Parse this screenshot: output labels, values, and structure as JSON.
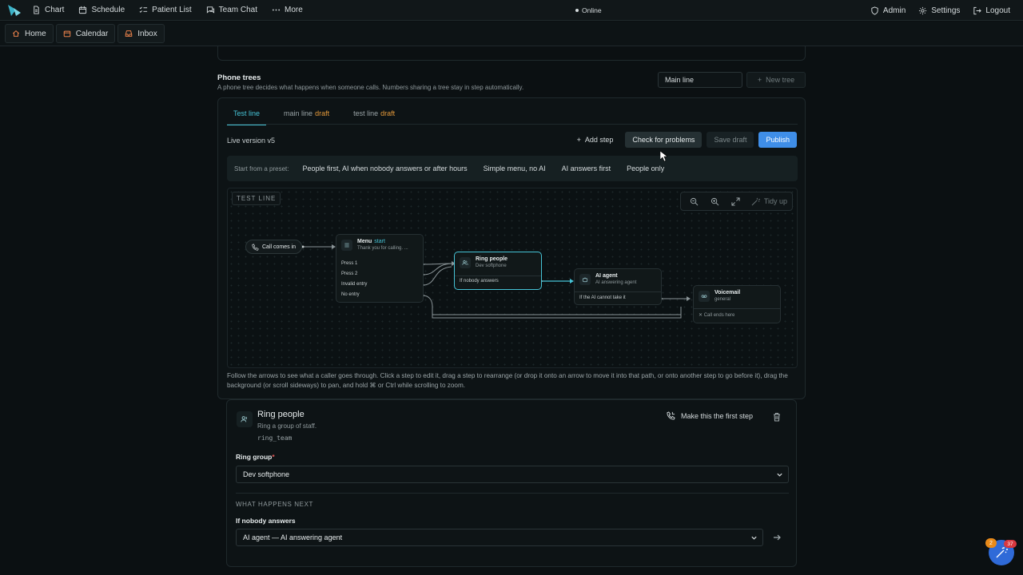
{
  "topbar": {
    "nav": [
      {
        "label": "Chart",
        "icon": "document-icon"
      },
      {
        "label": "Schedule",
        "icon": "calendar-icon"
      },
      {
        "label": "Patient List",
        "icon": "checklist-icon"
      },
      {
        "label": "Team Chat",
        "icon": "chat-icon"
      },
      {
        "label": "More",
        "icon": "more-dots-icon"
      }
    ],
    "status": "Online",
    "right": [
      {
        "label": "Admin",
        "icon": "shield-icon"
      },
      {
        "label": "Settings",
        "icon": "gear-icon"
      },
      {
        "label": "Logout",
        "icon": "logout-icon"
      }
    ]
  },
  "app_tabs": [
    {
      "label": "Home",
      "icon": "home-icon"
    },
    {
      "label": "Calendar",
      "icon": "calendar-icon"
    },
    {
      "label": "Inbox",
      "icon": "inbox-icon"
    }
  ],
  "phone_trees": {
    "title": "Phone trees",
    "description": "A phone tree decides what happens when someone calls. Numbers sharing a tree stay in step automatically.",
    "name_input_value": "Main line",
    "new_tree_label": "New tree"
  },
  "tree_tabs": [
    {
      "label": "Test line",
      "badge": ""
    },
    {
      "label": "main line",
      "badge": "draft"
    },
    {
      "label": "test line",
      "badge": "draft"
    }
  ],
  "editor": {
    "live_version": "Live version v5",
    "add_step": "Add step",
    "check": "Check for problems",
    "save_draft": "Save draft",
    "publish": "Publish",
    "preset_label": "Start from a preset:",
    "presets": [
      "People first, AI when nobody answers or after hours",
      "Simple menu, no AI",
      "AI answers first",
      "People only"
    ]
  },
  "canvas": {
    "title": "TEST LINE",
    "tidy_up": "Tidy up",
    "nodes": {
      "call_in": "Call comes in",
      "menu": {
        "title": "Menu",
        "badge": "start",
        "sub": "Thank you for calling. ...",
        "rows": [
          "Press 1",
          "Press 2",
          "Invalid entry",
          "No entry"
        ]
      },
      "ring": {
        "title": "Ring people",
        "sub": "Dev softphone",
        "row": "If nobody answers"
      },
      "ai": {
        "title": "AI agent",
        "sub": "AI answering agent",
        "row": "If the AI cannot take it"
      },
      "voicemail": {
        "title": "Voicemail",
        "sub": "general",
        "row": "Call ends here"
      }
    }
  },
  "help_text": "Follow the arrows to see what a caller goes through. Click a step to edit it, drag a step to rearrange (or drop it onto an arrow to move it into that path, or onto another step to go before it), drag the background (or scroll sideways) to pan, and hold ⌘ or Ctrl while scrolling to zoom.",
  "detail": {
    "title": "Ring people",
    "subtitle": "Ring a group of staff.",
    "code": "ring_team",
    "make_first": "Make this the first step",
    "ring_group_label": "Ring group",
    "ring_group_value": "Dev softphone",
    "next_heading": "WHAT HAPPENS NEXT",
    "nobody_label": "If nobody answers",
    "nobody_value": "AI agent — AI answering agent"
  },
  "fab": {
    "badge_orange": "2",
    "badge_red": "37"
  },
  "colors": {
    "accent": "#46c3d6",
    "publish": "#3f8ee8",
    "draft": "#e59a3a"
  }
}
